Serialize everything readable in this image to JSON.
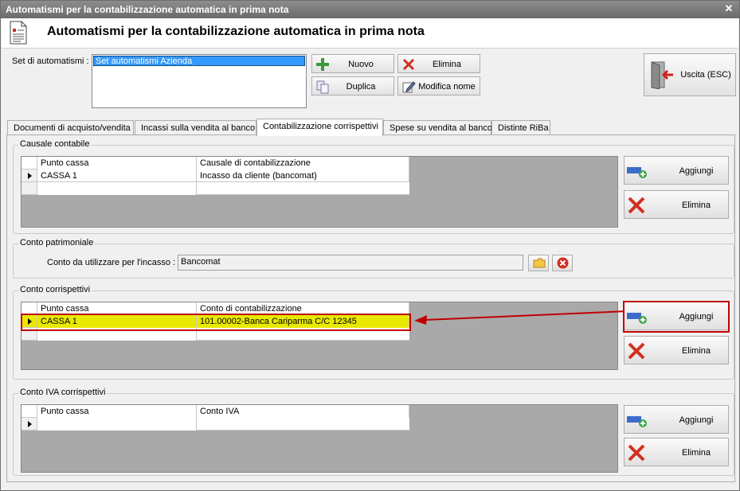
{
  "window": {
    "title": "Automatismi per la contabilizzazione automatica in prima nota",
    "close_symbol": "✕"
  },
  "header": {
    "title": "Automatismi per la contabilizzazione automatica in prima nota"
  },
  "set": {
    "label": "Set di automatismi :",
    "items": [
      "Set automatismi Azienda"
    ]
  },
  "toolbar": {
    "nuovo": "Nuovo",
    "elimina": "Elimina",
    "duplica": "Duplica",
    "modifica": "Modifica nome",
    "uscita": "Uscita (ESC)"
  },
  "tabs": [
    "Documenti di acquisto/vendita",
    "Incassi sulla vendita al banco",
    "Contabilizzazione corrispettivi",
    "Spese su vendita al banco",
    "Distinte RiBa"
  ],
  "active_tab": "Contabilizzazione corrispettivi",
  "causale": {
    "title": "Causale contabile",
    "columns": [
      "Punto cassa",
      "Causale di contabilizzazione"
    ],
    "rows": [
      [
        "CASSA 1",
        "Incasso da cliente (bancomat)"
      ]
    ],
    "add": "Aggiungi",
    "remove": "Elimina"
  },
  "patrimoniale": {
    "title": "Conto patrimoniale",
    "label": "Conto da utilizzare per l'incasso :",
    "value": "Bancomat"
  },
  "corrispettivi": {
    "title": "Conto corrispettivi",
    "columns": [
      "Punto cassa",
      "Conto di contabilizzazione"
    ],
    "rows": [
      [
        "CASSA 1",
        "101.00002-Banca Cariparma C/C 12345"
      ]
    ],
    "add": "Aggiungi",
    "remove": "Elimina"
  },
  "iva": {
    "title": "Conto IVA corrispettivi",
    "columns": [
      "Punto cassa",
      "Conto IVA"
    ],
    "add": "Aggiungi",
    "remove": "Elimina"
  },
  "colors": {
    "highlight_row": "#e8e800",
    "annotation": "#c00000",
    "selection": "#3399ff"
  }
}
